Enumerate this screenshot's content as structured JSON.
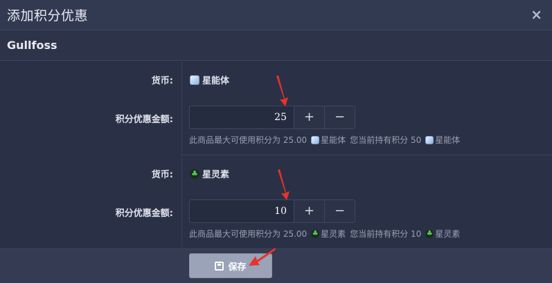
{
  "dialog": {
    "title": "添加积分优惠",
    "close_icon": "×",
    "subtitle": "Gullfoss"
  },
  "sections": [
    {
      "currency_label": "货币:",
      "currency_name": "星能体",
      "currency_icon": "cube-icon",
      "amount_label": "积分优惠金额:",
      "amount_value": "25",
      "plus": "+",
      "minus": "−",
      "hint_prefix": "此商品最大可使用积分为 25.00",
      "hint_currency1": "星能体",
      "hint_middle": "您当前持有积分 50",
      "hint_currency2": "星能体"
    },
    {
      "currency_label": "货币:",
      "currency_name": "星灵素",
      "currency_icon": "clover-icon",
      "amount_label": "积分优惠金额:",
      "amount_value": "10",
      "plus": "+",
      "minus": "−",
      "hint_prefix": "此商品最大可使用积分为 25.00",
      "hint_currency1": "星灵素",
      "hint_middle": "您当前持有积分 10",
      "hint_currency2": "星灵素"
    }
  ],
  "footer": {
    "save_label": "保存"
  },
  "colors": {
    "background": "#2a3147",
    "arrow": "#e8312a",
    "save_button": "#9aa3b8"
  }
}
